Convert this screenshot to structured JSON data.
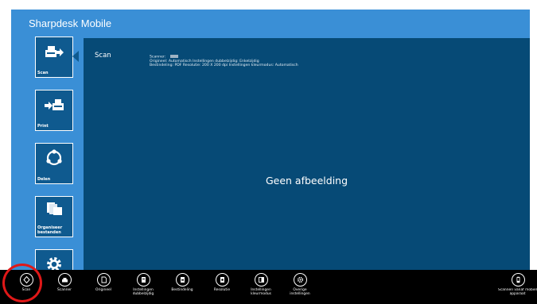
{
  "app": {
    "title": "Sharpdesk Mobile"
  },
  "nav": [
    {
      "label": "Scan",
      "icon": "scan-icon",
      "active": true
    },
    {
      "label": "Print",
      "icon": "print-icon",
      "active": false
    },
    {
      "label": "Delen",
      "icon": "share-icon",
      "active": false
    },
    {
      "label": "Organiseer bestanden",
      "icon": "folders-icon",
      "active": false
    },
    {
      "label": "",
      "icon": "gear-icon",
      "active": false
    }
  ],
  "panel": {
    "title": "Scan",
    "info_line1": "Scanner:",
    "info_line2": "Origineel: Automatisch   Instellingen dubbelzijdig: Enkelzijdig",
    "info_line3": "Bestindeling: PDF   Resolutie: 200 X 200 dpi   Instellingen kleurmodus: Automatisch",
    "placeholder": "Geen afbeelding"
  },
  "bottom_bar": [
    {
      "label": "Scan",
      "icon": "scan-start-icon"
    },
    {
      "label": "Scanner",
      "icon": "scanner-icon"
    },
    {
      "label": "Origineel",
      "icon": "original-icon"
    },
    {
      "label": "Instellingen dubbelzijdig",
      "icon": "duplex-icon"
    },
    {
      "label": "Bestindeling",
      "icon": "file-format-icon"
    },
    {
      "label": "Resolutie",
      "icon": "resolution-icon"
    },
    {
      "label": "Instellingen kleurmodus",
      "icon": "color-mode-icon"
    },
    {
      "label": "Overige instellingen",
      "icon": "settings-icon"
    },
    {
      "label": "Scannen vanaf mobiel apparaat",
      "icon": "mobile-scan-icon"
    }
  ],
  "colors": {
    "app_bg": "#3a8fd6",
    "panel_bg": "#064a76",
    "tile_bg": "#0f5a8f",
    "highlight": "#e01818"
  }
}
